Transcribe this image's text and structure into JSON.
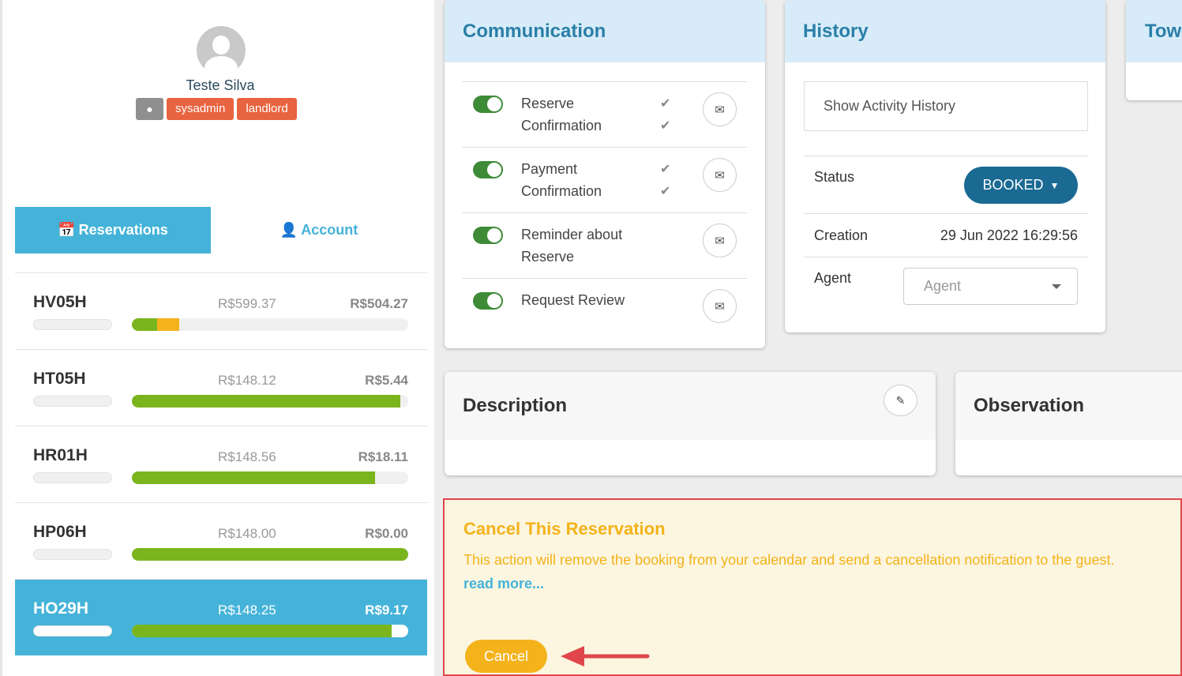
{
  "profile": {
    "name": "Teste Silva",
    "badges": [
      "sysadmin",
      "landlord"
    ],
    "globe_icon": "globe-icon"
  },
  "tabs": {
    "reservations": "Reservations",
    "account": "Account"
  },
  "reservations": [
    {
      "code": "HV05H",
      "total": "R$599.37",
      "balance": "R$504.27",
      "active": false,
      "progress": [
        {
          "fraction": 0.09,
          "color": "#7ab51d"
        },
        {
          "fraction": 0.08,
          "color": "#f4b21b"
        }
      ]
    },
    {
      "code": "HT05H",
      "total": "R$148.12",
      "balance": "R$5.44",
      "active": false,
      "progress": [
        {
          "fraction": 0.97,
          "color": "#7ab51d"
        }
      ]
    },
    {
      "code": "HR01H",
      "total": "R$148.56",
      "balance": "R$18.11",
      "active": false,
      "progress": [
        {
          "fraction": 0.88,
          "color": "#7ab51d"
        }
      ]
    },
    {
      "code": "HP06H",
      "total": "R$148.00",
      "balance": "R$0.00",
      "active": false,
      "progress": [
        {
          "fraction": 1.0,
          "color": "#7ab51d"
        }
      ]
    },
    {
      "code": "HO29H",
      "total": "R$148.25",
      "balance": "R$9.17",
      "active": true,
      "progress": [
        {
          "fraction": 0.94,
          "color": "#7ab51d"
        }
      ]
    }
  ],
  "communication": {
    "title": "Communication",
    "items": [
      {
        "label": "Reserve Confirmation",
        "enabled": true,
        "checks": 2
      },
      {
        "label": "Payment Confirmation",
        "enabled": true,
        "checks": 2
      },
      {
        "label": "Reminder about Reserve",
        "enabled": true,
        "checks": 0
      },
      {
        "label": "Request Review",
        "enabled": true,
        "checks": 0
      }
    ]
  },
  "history": {
    "title": "History",
    "show_activity": "Show Activity History",
    "status_label": "Status",
    "status_value": "BOOKED",
    "creation_label": "Creation",
    "creation_value": "29 Jun 2022 16:29:56",
    "agent_label": "Agent",
    "agent_placeholder": "Agent"
  },
  "partial_card": {
    "title": "Tow"
  },
  "description": {
    "title": "Description"
  },
  "observation": {
    "title": "Observation"
  },
  "cancel": {
    "title": "Cancel This Reservation",
    "description": "This action will remove the booking from your calendar and send a cancellation notification to the guest.",
    "read_more": "read more...",
    "button": "Cancel"
  },
  "colors": {
    "accent": "#45b3d9",
    "booked": "#1a6a93",
    "toggle_on": "#3e8b37",
    "warning": "#f4b21b",
    "badge": "#e8633f",
    "highlight": "#e0464c"
  }
}
